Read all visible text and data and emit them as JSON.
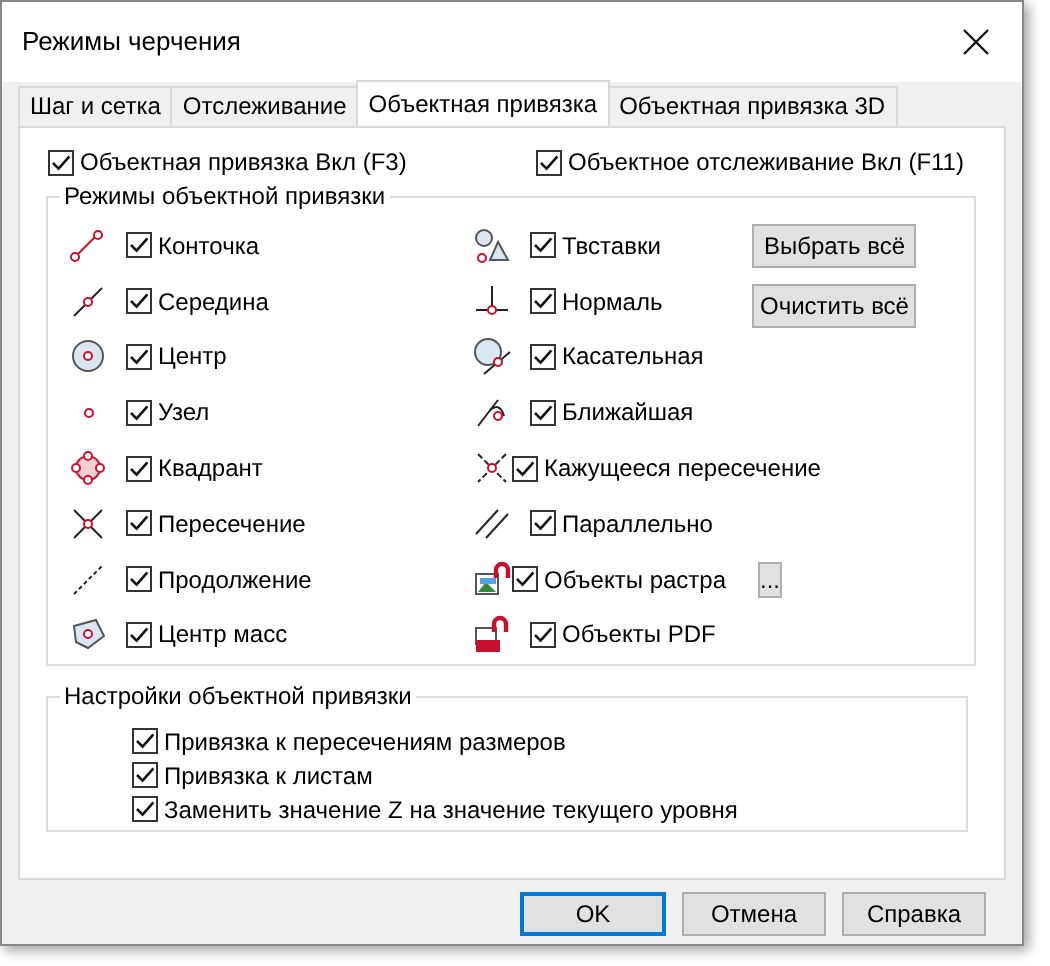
{
  "window": {
    "title": "Режимы черчения"
  },
  "tabs": [
    {
      "label": "Шаг и сетка",
      "selected": false
    },
    {
      "label": "Отслеживание",
      "selected": false
    },
    {
      "label": "Объектная привязка",
      "selected": true
    },
    {
      "label": "Объектная привязка 3D",
      "selected": false
    }
  ],
  "toggles": [
    {
      "label": "Объектная привязка Вкл (F3)",
      "checked": true
    },
    {
      "label": "Объектное отслеживание Вкл (F11)",
      "checked": true
    }
  ],
  "snap_modes": {
    "title": "Режимы объектной привязки",
    "left": [
      {
        "label": "Конточка",
        "checked": true
      },
      {
        "label": "Середина",
        "checked": true
      },
      {
        "label": "Центр",
        "checked": true
      },
      {
        "label": "Узел",
        "checked": true
      },
      {
        "label": "Квадрант",
        "checked": true
      },
      {
        "label": "Пересечение",
        "checked": true
      },
      {
        "label": "Продолжение",
        "checked": true
      },
      {
        "label": "Центр масс",
        "checked": true
      }
    ],
    "right": [
      {
        "label": "Твставки",
        "checked": true
      },
      {
        "label": "Нормаль",
        "checked": true
      },
      {
        "label": "Касательная",
        "checked": true
      },
      {
        "label": "Ближайшая",
        "checked": true
      },
      {
        "label": "Кажущееся пересечение",
        "checked": true
      },
      {
        "label": "Параллельно",
        "checked": true
      },
      {
        "label": "Объекты растра",
        "checked": true,
        "more": "..."
      },
      {
        "label": "Объекты PDF",
        "checked": true
      }
    ],
    "buttons": [
      "Выбрать всё",
      "Очистить всё"
    ]
  },
  "settings": {
    "title": "Настройки объектной привязки",
    "items": [
      {
        "label": "Привязка к пересечениям размеров",
        "checked": true
      },
      {
        "label": "Привязка к листам",
        "checked": true
      },
      {
        "label": "Заменить значение Z на значение текущего уровня",
        "checked": true
      }
    ]
  },
  "footer_buttons": [
    {
      "label": "OK",
      "default": true
    },
    {
      "label": "Отмена",
      "default": false
    },
    {
      "label": "Справка",
      "default": false
    }
  ]
}
